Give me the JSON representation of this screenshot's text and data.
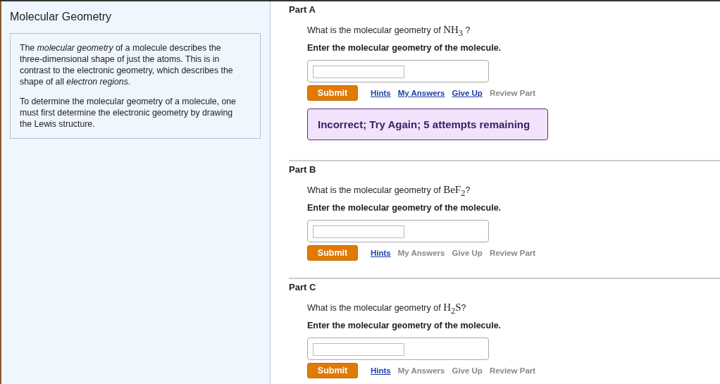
{
  "sidebar": {
    "title": "Molecular Geometry",
    "paragraphs": [
      "The *molecular geometry* of a molecule describes the three-dimensional shape of just the atoms. This is in contrast to the electronic geometry, which describes the shape of all *electron regions*.",
      "To determine the molecular geometry of a molecule, one must first determine the electronic geometry by drawing the Lewis structure."
    ]
  },
  "parts": [
    {
      "title": "Part A",
      "question_prefix": "What is the molecular geometry of ",
      "formula": "NH$_{3}$",
      "question_suffix": " ?",
      "instruction": "Enter the molecular geometry of the molecule.",
      "submit": "Submit",
      "links": [
        {
          "label": "Hints",
          "disabled": false
        },
        {
          "label": "My Answers",
          "disabled": false
        },
        {
          "label": "Give Up",
          "disabled": false
        },
        {
          "label": "Review Part",
          "disabled": true
        }
      ],
      "feedback": {
        "kind": "incorrect",
        "text": "Incorrect; Try Again; 5 attempts remaining"
      }
    },
    {
      "title": "Part B",
      "question_prefix": "What is the molecular geometry of ",
      "formula": "BeF$_{2}$",
      "question_suffix": "?",
      "instruction": "Enter the molecular geometry of the molecule.",
      "submit": "Submit",
      "links": [
        {
          "label": "Hints",
          "disabled": false
        },
        {
          "label": "My Answers",
          "disabled": true
        },
        {
          "label": "Give Up",
          "disabled": true
        },
        {
          "label": "Review Part",
          "disabled": true
        }
      ]
    },
    {
      "title": "Part C",
      "question_prefix": "What is the molecular geometry of ",
      "formula": "H$_{2}$S",
      "question_suffix": "?",
      "instruction": "Enter the molecular geometry of the molecule.",
      "submit": "Submit",
      "links": [
        {
          "label": "Hints",
          "disabled": false
        },
        {
          "label": "My Answers",
          "disabled": true
        },
        {
          "label": "Give Up",
          "disabled": true
        },
        {
          "label": "Review Part",
          "disabled": true
        }
      ]
    }
  ]
}
